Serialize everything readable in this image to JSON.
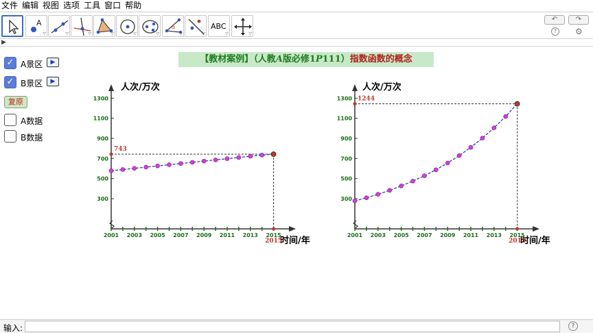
{
  "menu": [
    "文件",
    "编辑",
    "视图",
    "选项",
    "工具",
    "窗口",
    "帮助"
  ],
  "toolbar": {
    "tools": [
      "move-tool",
      "point-tool",
      "line-tool",
      "perpendicular-tool",
      "polygon-tool",
      "circle-tool",
      "conic-tool",
      "angle-tool",
      "reflect-tool",
      "text-tool",
      "move-view-tool"
    ],
    "text_tool_label": "ABC",
    "undo_label": "↶",
    "redo_label": "↷",
    "help_icon": "?",
    "settings_icon": "⚙"
  },
  "panel": {
    "checkbox_a_scene": {
      "label": "A景区",
      "checked": true
    },
    "checkbox_b_scene": {
      "label": "B景区",
      "checked": true
    },
    "reset_label": "复原",
    "checkbox_a_data": {
      "label": "A数据",
      "checked": false
    },
    "checkbox_b_data": {
      "label": "B数据",
      "checked": false
    }
  },
  "title": {
    "part1": "【教材案例】（人教",
    "part2": "A",
    "part3": "版必修1",
    "part4": "P",
    "part5": "111）",
    "part6": "指数函数的概念"
  },
  "input_bar": {
    "label": "输入:",
    "value": "",
    "help_icon": "?"
  },
  "colors": {
    "axis_tick_label": "#1a6e1a",
    "point_fill": "#d63be0",
    "curve": "#2b3f9e",
    "highlight": "#c0392b",
    "title_bg": "#c8e9c8"
  },
  "chart_data": [
    {
      "type": "scatter",
      "ylabel": "人次/万次",
      "xlabel": "时间/年",
      "x": [
        2001,
        2002,
        2003,
        2004,
        2005,
        2006,
        2007,
        2008,
        2009,
        2010,
        2011,
        2012,
        2013,
        2014
      ],
      "y": [
        578,
        590,
        602,
        614,
        626,
        638,
        650,
        662,
        674,
        686,
        698,
        710,
        722,
        734
      ],
      "x_ticks": [
        2001,
        2003,
        2005,
        2007,
        2009,
        2011,
        2013,
        2015
      ],
      "y_ticks": [
        300,
        500,
        700,
        900,
        1100,
        1300
      ],
      "highlight": {
        "x": 2015,
        "y": 743,
        "x_label": "2015",
        "y_label": "743"
      },
      "xlim": [
        2001,
        2016.8
      ],
      "ylim": [
        0,
        1400
      ]
    },
    {
      "type": "scatter",
      "ylabel": "人次/万次",
      "xlabel": "时间/年",
      "x": [
        2001,
        2002,
        2003,
        2004,
        2005,
        2006,
        2007,
        2008,
        2009,
        2010,
        2011,
        2012,
        2013,
        2014
      ],
      "y": [
        278,
        309,
        344,
        383,
        427,
        475,
        528,
        588,
        655,
        729,
        811,
        903,
        1005,
        1118
      ],
      "x_ticks": [
        2001,
        2003,
        2005,
        2007,
        2009,
        2011,
        2013,
        2015
      ],
      "y_ticks": [
        300,
        500,
        700,
        900,
        1100,
        1300
      ],
      "highlight": {
        "x": 2015,
        "y": 1244,
        "x_label": "2015",
        "y_label": "1244"
      },
      "xlim": [
        2001,
        2016.8
      ],
      "ylim": [
        0,
        1400
      ]
    }
  ]
}
